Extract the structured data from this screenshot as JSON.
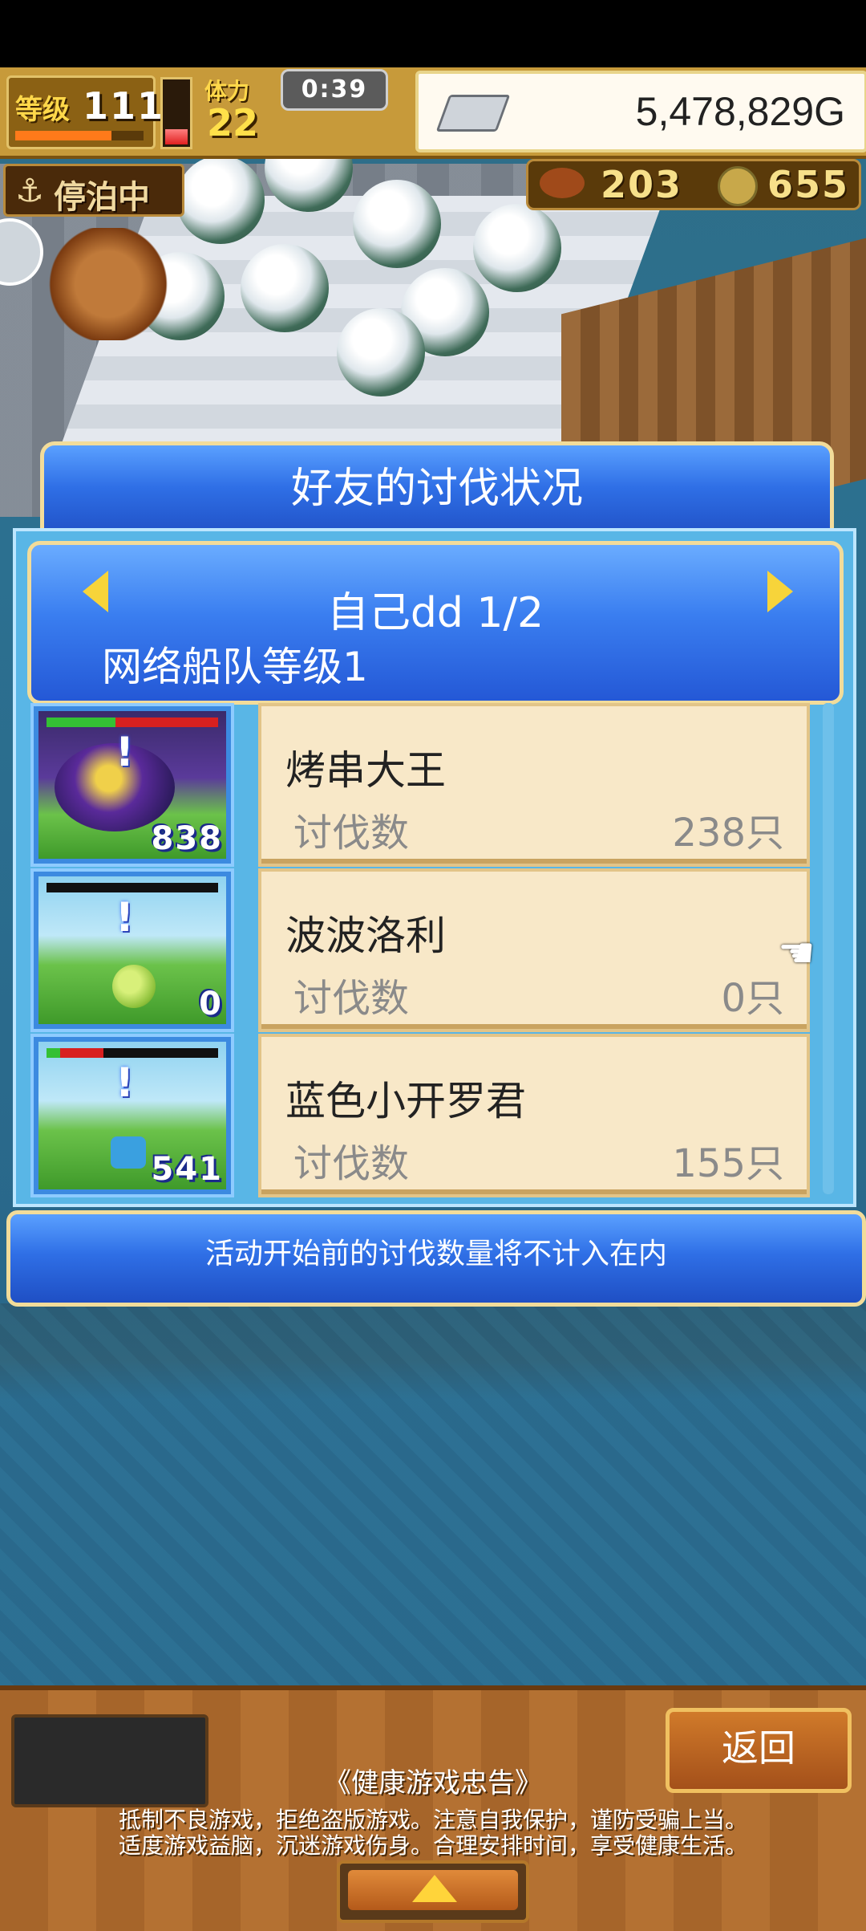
{
  "hud": {
    "level_label": "等级",
    "level_value": "111",
    "exp_fraction": 0.75,
    "stamina_fraction": 0.3,
    "stamina_label": "体力",
    "stamina_value": "22",
    "timer": "0:39",
    "money": "5,478,829G",
    "money_icon": "silver-ingot-icon",
    "anchor_status": "停泊中",
    "fish_count": "203",
    "coin_count": "655"
  },
  "dialog": {
    "title": "好友的讨伐状况",
    "friend_name": "自己dd 1/2",
    "fleet_level": "网络船队等级1",
    "footer_note": "活动开始前的讨伐数量将不计入在内",
    "rows": [
      {
        "name": "烤串大王",
        "label": "讨伐数",
        "count": "238只",
        "badge": "838",
        "hp_green": 0.4,
        "hp_red": 0.6
      },
      {
        "name": "波波洛利",
        "label": "讨伐数",
        "count": "0只",
        "badge": "0",
        "hp_green": 0,
        "hp_red": 0
      },
      {
        "name": "蓝色小开罗君",
        "label": "讨伐数",
        "count": "155只",
        "badge": "541",
        "hp_green": 0.08,
        "hp_red": 0.25
      }
    ]
  },
  "bottom": {
    "back_label": "返回",
    "notice_title": "《健康游戏忠告》",
    "notice_line1": "抵制不良游戏，拒绝盗版游戏。注意自我保护，谨防受骗上当。",
    "notice_line2": "适度游戏益脑，沉迷游戏伤身。合理安排时间，享受健康生活。"
  },
  "colors": {
    "dialog_blue": "#2f6fe6",
    "card_bg": "#f8e8c8",
    "gold_border": "#f2dc9a"
  }
}
